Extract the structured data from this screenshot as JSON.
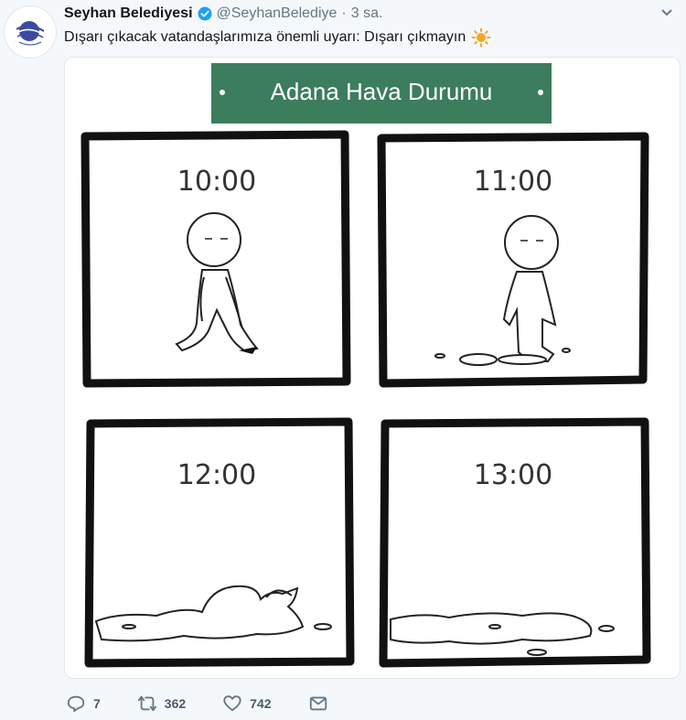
{
  "tweet": {
    "author_name": "Seyhan Belediyesi",
    "author_handle": "@SeyhanBelediye",
    "separator": "·",
    "time": "3 sa.",
    "text": "Dışarı çıkacak vatandaşlarımıza önemli uyarı: Dışarı çıkmayın",
    "text_emoji": "sun-emoji"
  },
  "media": {
    "banner_title": "Adana Hava Durumu",
    "banner_color": "#3c7d5e",
    "panels": [
      {
        "time": "10:00"
      },
      {
        "time": "11:00"
      },
      {
        "time": "12:00"
      },
      {
        "time": "13:00"
      }
    ]
  },
  "actions": {
    "replies": "7",
    "retweets": "362",
    "likes": "742"
  },
  "colors": {
    "verified": "#1da1f2",
    "muted_text": "#657786",
    "sun": "#f5a623"
  }
}
